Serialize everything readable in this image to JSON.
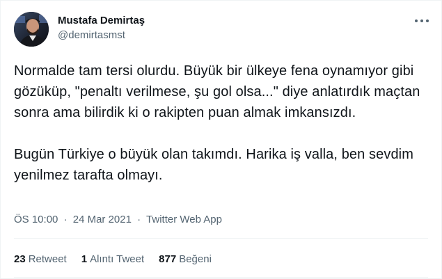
{
  "author": {
    "name": "Mustafa Demirtaş",
    "handle": "@demirtasmst",
    "avatar": "avatar-photo"
  },
  "tweet": {
    "text": "Normalde tam tersi olurdu. Büyük bir ülkeye fena oynamıyor gibi gözüküp, \"penaltı verilmese, şu gol olsa...\" diye anlatırdık maçtan sonra ama bilirdik ki o rakipten puan almak imkansızdı.\n\nBugün Türkiye o büyük olan takımdı. Harika iş valla, ben sevdim yenilmez tarafta olmayı."
  },
  "meta": {
    "time": "ÖS 10:00",
    "separator": "·",
    "date": "24 Mar 2021",
    "source": "Twitter Web App"
  },
  "stats": {
    "retweets": {
      "count": "23",
      "label": "Retweet"
    },
    "quotes": {
      "count": "1",
      "label": "Alıntı Tweet"
    },
    "likes": {
      "count": "877",
      "label": "Beğeni"
    }
  },
  "icons": {
    "more": "more-horizontal-icon"
  },
  "colors": {
    "text_primary": "#0f1419",
    "text_secondary": "#536471",
    "divider": "#eff3f4"
  }
}
